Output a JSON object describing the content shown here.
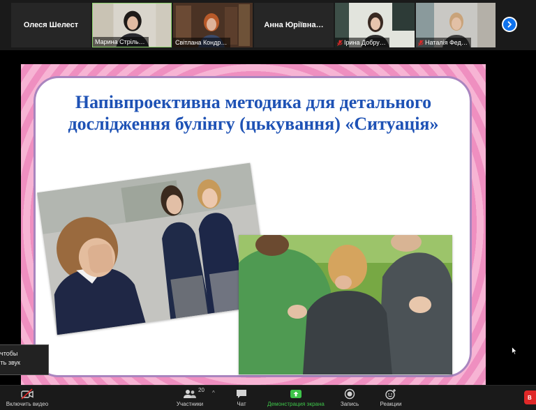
{
  "participants": [
    {
      "name": "Олеся Шелест",
      "display": "name-only",
      "muted": false
    },
    {
      "name": "Марина Стріль…",
      "display": "video",
      "muted": false,
      "speaking": true
    },
    {
      "name": "Світлана Кондр…",
      "display": "video",
      "muted": false
    },
    {
      "name": "Анна Юріївна…",
      "display": "name-only",
      "muted": false
    },
    {
      "name": "Ірина Добру…",
      "display": "video",
      "muted": true
    },
    {
      "name": "Наталія Фед…",
      "display": "video",
      "muted": true
    }
  ],
  "strip": {
    "next_icon": "chevron-right-icon",
    "accent": "#0e72ed",
    "speaker_highlight": "#8bd36a"
  },
  "slide": {
    "title_line1": "Напівпроективна методика для детального",
    "title_line2": "дослідження булінгу (цькування) «Ситуація»",
    "title_color": "#1e52b5",
    "border_color": "#a985bf",
    "background_color": "#f4a6cc"
  },
  "notification": {
    "line1": "те, чтобы",
    "line2": "очить звук"
  },
  "toolbar": {
    "video_label": "Включить видео",
    "video_icon": "video-off-icon",
    "participants_label": "Участники",
    "participants_count": "20",
    "participants_icon": "people-icon",
    "chat_label": "Чат",
    "chat_icon": "chat-icon",
    "share_label": "Демонстрация экрана",
    "share_icon": "share-screen-icon",
    "share_color": "#3ec44a",
    "record_label": "Запись",
    "record_icon": "record-icon",
    "reactions_label": "Реакции",
    "reactions_icon": "smiley-add-icon",
    "end_label": "В",
    "end_color": "#e02828"
  }
}
